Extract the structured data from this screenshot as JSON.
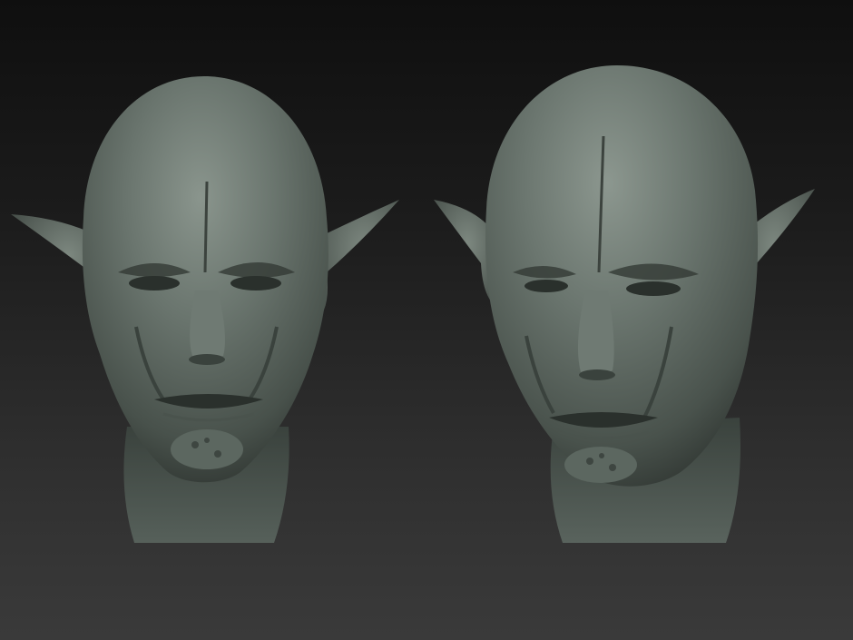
{
  "viewport": {
    "background_top": "#0f0f0f",
    "background_bottom": "#3a3a3a"
  },
  "sculpts": [
    {
      "name": "goblin-head-front",
      "material_color": "#5f6a63"
    },
    {
      "name": "goblin-head-three-quarter",
      "material_color": "#5f6a63"
    }
  ]
}
